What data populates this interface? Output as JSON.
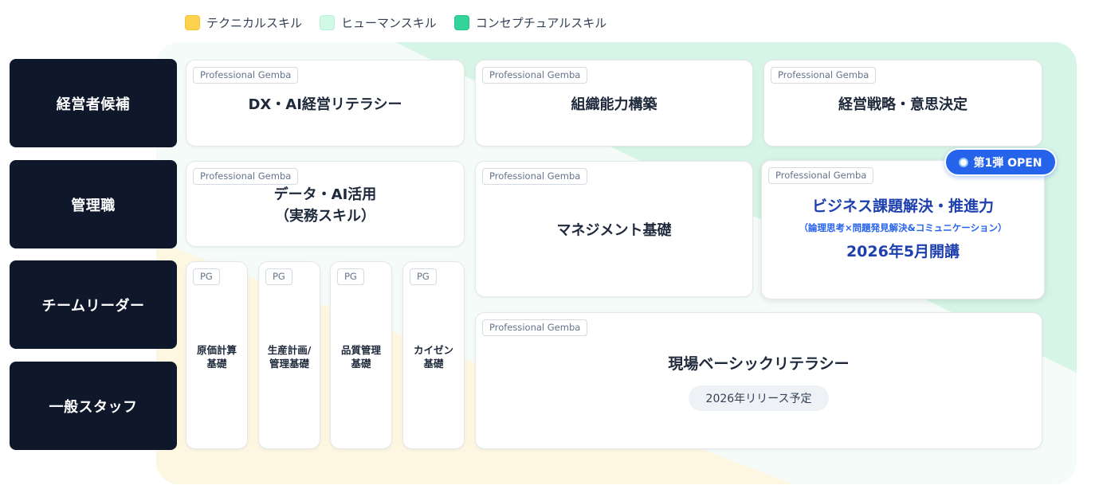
{
  "legend": {
    "technical": "テクニカルスキル",
    "human": "ヒューマンスキル",
    "conceptual": "コンセプチュアルスキル"
  },
  "colors": {
    "technical": "#fdd34d",
    "human": "#d1fae5",
    "conceptual": "#34d399",
    "label_bg": "#0f172a",
    "accent": "#2563eb"
  },
  "rows": {
    "executive": "経営者候補",
    "manager": "管理職",
    "team_leader": "チームリーダー",
    "staff": "一般スタッフ"
  },
  "tag_full": "Professional Gemba",
  "tag_short": "PG",
  "cards": {
    "dx_ai": "DX・AI経営リテラシー",
    "org_capability": "組織能力構築",
    "strategy": "経営戦略・意思決定",
    "data_ai_line1": "データ・AI活用",
    "data_ai_line2": "（実務スキル）",
    "management_basics": "マネジメント基礎",
    "business_title": "ビジネス課題解決・推進力",
    "business_sub": "（論理思考×問題発見解決&コミュニケーション）",
    "business_date": "2026年5月開講",
    "open_badge": "第1弾 OPEN",
    "field_literacy": "現場ベーシックリテラシー",
    "field_release": "2026年リリース予定"
  },
  "pg_cards": [
    {
      "line1": "原価計算",
      "line2": "基礎"
    },
    {
      "line1": "生産計画/",
      "line2": "管理基礎"
    },
    {
      "line1": "品質管理",
      "line2": "基礎"
    },
    {
      "line1": "カイゼン",
      "line2": "基礎"
    }
  ]
}
